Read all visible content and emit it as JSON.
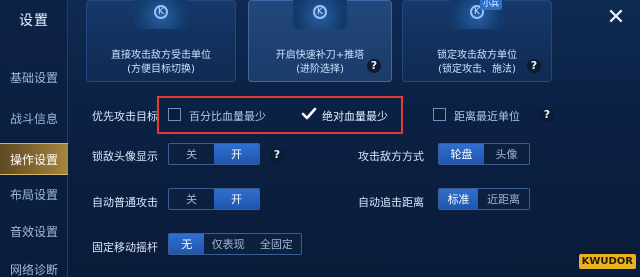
{
  "sidebar": {
    "title": "设置",
    "items": [
      {
        "label": "基础设置"
      },
      {
        "label": "战斗信息"
      },
      {
        "label": "操作设置"
      },
      {
        "label": "布局设置"
      },
      {
        "label": "音效设置"
      },
      {
        "label": "网络诊断"
      }
    ]
  },
  "top_cards": [
    {
      "desc": "直接攻击敌方受击单位\n(方便目标切换)"
    },
    {
      "desc": "开启快速补刀+推塔\n(进阶选择)",
      "selected": true
    },
    {
      "desc": "锁定攻击敌方单位\n(锁定攻击、施法)",
      "badge": "小兵"
    }
  ],
  "priority": {
    "label": "优先攻击目标",
    "options": [
      {
        "label": "百分比血量最少",
        "checked": false
      },
      {
        "label": "绝对血量最少",
        "checked": true
      },
      {
        "label": "距离最近单位",
        "checked": false
      }
    ]
  },
  "lock_avatar": {
    "label": "锁敌头像显示",
    "off": "关",
    "on": "开"
  },
  "attack_mode": {
    "label": "攻击敌方方式",
    "a": "轮盘",
    "b": "头像"
  },
  "auto_attack": {
    "label": "自动普通攻击",
    "off": "关",
    "on": "开"
  },
  "auto_chase": {
    "label": "自动追击距离",
    "a": "标准",
    "b": "近距离"
  },
  "joystick": {
    "label": "固定移动摇杆",
    "a": "无",
    "b": "仅表现",
    "c": "全固定"
  },
  "qmark": "?",
  "close": "✕",
  "watermark": "KWUDOR"
}
